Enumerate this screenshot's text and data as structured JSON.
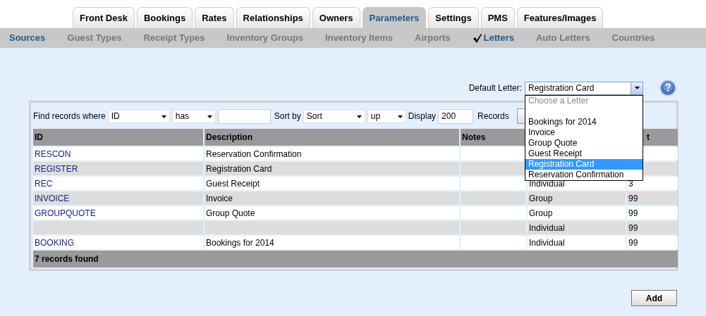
{
  "main_tabs": [
    {
      "label": "Front Desk",
      "selected": false
    },
    {
      "label": "Bookings",
      "selected": false
    },
    {
      "label": "Rates",
      "selected": false
    },
    {
      "label": "Relationships",
      "selected": false
    },
    {
      "label": "Owners",
      "selected": false
    },
    {
      "label": "Parameters",
      "selected": true
    },
    {
      "label": "Settings",
      "selected": false
    },
    {
      "label": "PMS",
      "selected": false
    },
    {
      "label": "Features/Images",
      "selected": false
    }
  ],
  "section_label": "Sources",
  "sub_tabs": [
    {
      "label": "Guest Types",
      "selected": false
    },
    {
      "label": "Receipt Types",
      "selected": false
    },
    {
      "label": "Inventory Groups",
      "selected": false
    },
    {
      "label": "Inventory Items",
      "selected": false
    },
    {
      "label": "Airports",
      "selected": false
    },
    {
      "label": "Letters",
      "selected": true
    },
    {
      "label": "Auto Letters",
      "selected": false
    },
    {
      "label": "Countries",
      "selected": false
    }
  ],
  "default_letter": {
    "label": "Default Letter:",
    "value": "Registration Card",
    "expanded": true,
    "options": [
      {
        "kind": "placeholder",
        "label": "Choose a Letter",
        "selected": false
      },
      {
        "kind": "blank",
        "selected": false
      },
      {
        "kind": "option",
        "label": "Bookings for 2014",
        "selected": false
      },
      {
        "kind": "option",
        "label": "Invoice",
        "selected": false
      },
      {
        "kind": "option",
        "label": "Group Quote",
        "selected": false
      },
      {
        "kind": "option",
        "label": "Guest Receipt",
        "selected": false
      },
      {
        "kind": "option",
        "label": "Registration Card",
        "selected": true
      },
      {
        "kind": "option",
        "label": "Reservation Confirmation",
        "selected": false
      }
    ]
  },
  "filter": {
    "label": "Find records where",
    "field": "ID",
    "operator": "has",
    "sort_label": "Sort by",
    "sort_field": "Sort",
    "sort_direction": "up",
    "display_label": "Display",
    "display_value": "200",
    "records_label": "Records"
  },
  "table": {
    "columns": {
      "id": "ID",
      "description": "Description",
      "notes": "Notes",
      "column_5": "t"
    },
    "rows": [
      {
        "id": "RESCON",
        "description": "Reservation Confirmation"
      },
      {
        "id": "REGISTER",
        "description": "Registration Card"
      },
      {
        "id": "REC",
        "description": "Guest Receipt",
        "column_4": "Individual",
        "column_5": "3"
      },
      {
        "id": "INVOICE",
        "description": "Invoice",
        "column_4": "Group",
        "column_5": "99"
      },
      {
        "id": "GROUPQUOTE",
        "description": "Group Quote",
        "column_4": "Group",
        "column_5": "99"
      },
      {
        "column_4": "Individual",
        "column_5": "99"
      },
      {
        "id": "BOOKING",
        "description": "Bookings for 2014",
        "column_4": "Individual",
        "column_5": "99"
      }
    ],
    "footer": "7 records found"
  },
  "add_button": "Add"
}
